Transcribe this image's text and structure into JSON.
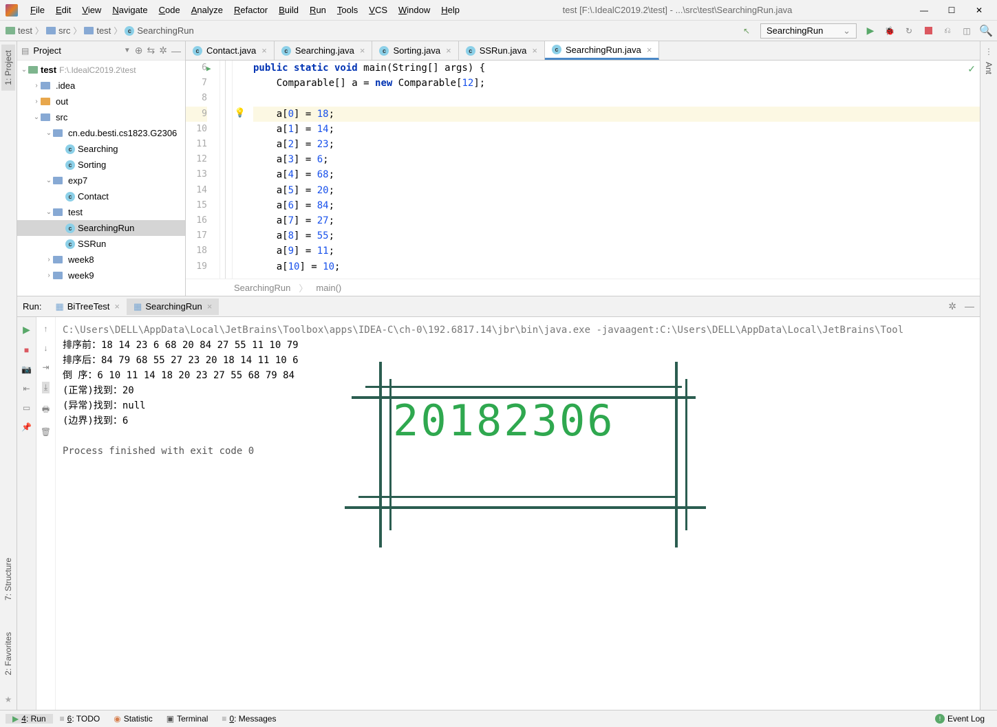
{
  "window": {
    "title": "test [F:\\.IdealC2019.2\\test] - ...\\src\\test\\SearchingRun.java"
  },
  "menubar": [
    "File",
    "Edit",
    "View",
    "Navigate",
    "Code",
    "Analyze",
    "Refactor",
    "Build",
    "Run",
    "Tools",
    "VCS",
    "Window",
    "Help"
  ],
  "breadcrumb": {
    "items": [
      "test",
      "src",
      "test",
      "SearchingRun"
    ]
  },
  "run_config": "SearchingRun",
  "sidebar": {
    "left": [
      {
        "label": "1: Project",
        "active": true
      },
      {
        "label": "7: Structure",
        "active": false
      },
      {
        "label": "2: Favorites",
        "active": false
      }
    ],
    "right": [
      {
        "label": "Ant"
      }
    ]
  },
  "project": {
    "title": "Project",
    "root": {
      "name": "test",
      "path": "F:\\.IdealC2019.2\\test"
    },
    "tree": [
      {
        "indent": 1,
        "arrow": ">",
        "icon": "folder-b",
        "label": ".idea"
      },
      {
        "indent": 1,
        "arrow": ">",
        "icon": "folder-y",
        "label": "out"
      },
      {
        "indent": 1,
        "arrow": "v",
        "icon": "folder-b",
        "label": "src"
      },
      {
        "indent": 2,
        "arrow": "v",
        "icon": "folder-b",
        "label": "cn.edu.besti.cs1823.G2306"
      },
      {
        "indent": 3,
        "arrow": "",
        "icon": "java",
        "label": "Searching"
      },
      {
        "indent": 3,
        "arrow": "",
        "icon": "java",
        "label": "Sorting"
      },
      {
        "indent": 2,
        "arrow": "v",
        "icon": "folder-b",
        "label": "exp7"
      },
      {
        "indent": 3,
        "arrow": "",
        "icon": "java",
        "label": "Contact"
      },
      {
        "indent": 2,
        "arrow": "v",
        "icon": "folder-b",
        "label": "test",
        "selected_parent": true
      },
      {
        "indent": 3,
        "arrow": "",
        "icon": "java",
        "label": "SearchingRun",
        "selected": true
      },
      {
        "indent": 3,
        "arrow": "",
        "icon": "java",
        "label": "SSRun"
      },
      {
        "indent": 2,
        "arrow": ">",
        "icon": "folder-b",
        "label": "week8"
      },
      {
        "indent": 2,
        "arrow": ">",
        "icon": "folder-b",
        "label": "week9"
      }
    ]
  },
  "editor": {
    "tabs": [
      {
        "name": "Contact.java",
        "active": false
      },
      {
        "name": "Searching.java",
        "active": false
      },
      {
        "name": "Sorting.java",
        "active": false
      },
      {
        "name": "SSRun.java",
        "active": false
      },
      {
        "name": "SearchingRun.java",
        "active": true
      }
    ],
    "line_start": 6,
    "lines": [
      {
        "n": 6,
        "html": "<span class='kw'>public static void</span> main(String[] args) {"
      },
      {
        "n": 7,
        "html": "    Comparable[] a = <span class='kw'>new</span> Comparable[<span class='num'>12</span>];"
      },
      {
        "n": 8,
        "html": ""
      },
      {
        "n": 9,
        "html": "    a[<span class='num'>0</span>] = <span class='num'>18</span>;",
        "highlight": true
      },
      {
        "n": 10,
        "html": "    a[<span class='num'>1</span>] = <span class='num'>14</span>;"
      },
      {
        "n": 11,
        "html": "    a[<span class='num'>2</span>] = <span class='num'>23</span>;"
      },
      {
        "n": 12,
        "html": "    a[<span class='num'>3</span>] = <span class='num'>6</span>;"
      },
      {
        "n": 13,
        "html": "    a[<span class='num'>4</span>] = <span class='num'>68</span>;"
      },
      {
        "n": 14,
        "html": "    a[<span class='num'>5</span>] = <span class='num'>20</span>;"
      },
      {
        "n": 15,
        "html": "    a[<span class='num'>6</span>] = <span class='num'>84</span>;"
      },
      {
        "n": 16,
        "html": "    a[<span class='num'>7</span>] = <span class='num'>27</span>;"
      },
      {
        "n": 17,
        "html": "    a[<span class='num'>8</span>] = <span class='num'>55</span>;"
      },
      {
        "n": 18,
        "html": "    a[<span class='num'>9</span>] = <span class='num'>11</span>;"
      },
      {
        "n": 19,
        "html": "    a[<span class='num'>10</span>] = <span class='num'>10</span>;"
      }
    ],
    "footer": [
      "SearchingRun",
      "main()"
    ]
  },
  "run": {
    "header_label": "Run:",
    "tabs": [
      {
        "name": "BiTreeTest",
        "active": false
      },
      {
        "name": "SearchingRun",
        "active": true
      }
    ],
    "console": [
      {
        "cls": "path",
        "text": "C:\\Users\\DELL\\AppData\\Local\\JetBrains\\Toolbox\\apps\\IDEA-C\\ch-0\\192.6817.14\\jbr\\bin\\java.exe -javaagent:C:\\Users\\DELL\\AppData\\Local\\JetBrains\\Tool"
      },
      {
        "cls": "",
        "text": "排序前：18 14 23 6 68 20 84 27 55 11 10 79"
      },
      {
        "cls": "",
        "text": "排序后：84 79 68 55 27 23 20 18 14 11 10 6"
      },
      {
        "cls": "",
        "text": "倒  序：6 10 11 14 18 20 23 27 55 68 79 84"
      },
      {
        "cls": "",
        "text": "(正常)找到：20"
      },
      {
        "cls": "",
        "text": "(异常)找到：null"
      },
      {
        "cls": "",
        "text": "(边界)找到：6"
      },
      {
        "cls": "",
        "text": ""
      },
      {
        "cls": "exit",
        "text": "Process finished with exit code 0"
      }
    ],
    "watermark": "20182306"
  },
  "statusbar": {
    "items": [
      {
        "label": "4: Run",
        "active": true
      },
      {
        "label": "6: TODO"
      },
      {
        "label": "Statistic"
      },
      {
        "label": "Terminal"
      },
      {
        "label": "0: Messages"
      }
    ],
    "right": "Event Log"
  }
}
